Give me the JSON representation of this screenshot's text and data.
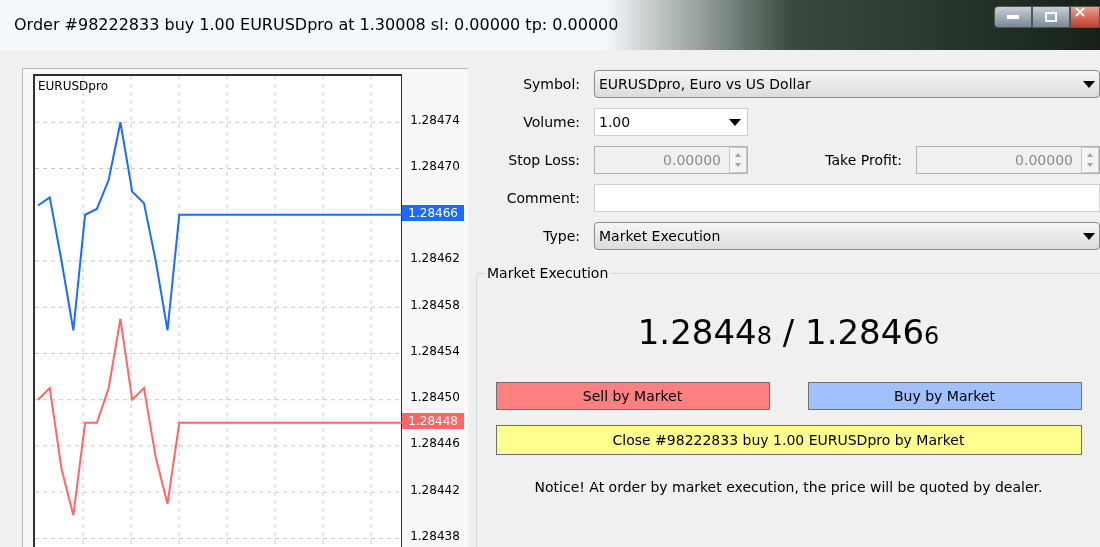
{
  "window": {
    "title": "Order #98222833 buy 1.00 EURUSDpro at 1.30008 sl: 0.00000 tp: 0.00000"
  },
  "chart": {
    "symbol": "EURUSDpro",
    "ask_label": "1.28466",
    "bid_label": "1.28448",
    "chart_data": {
      "type": "line",
      "categories": [
        null,
        null,
        null,
        null,
        null,
        null,
        null,
        null,
        null,
        null,
        null,
        null,
        null,
        null,
        null,
        null,
        null,
        null,
        null,
        null,
        null,
        null,
        null,
        null,
        null,
        null,
        null,
        null,
        null,
        null,
        null,
        null
      ],
      "ylim": [
        1.28437,
        1.28478
      ],
      "grid": true,
      "yticks": [
        {
          "value": 1.28474,
          "label": "1.28474"
        },
        {
          "value": 1.2847,
          "label": "1.28470"
        },
        {
          "value": 1.28462,
          "label": "1.28462"
        },
        {
          "value": 1.28458,
          "label": "1.28458"
        },
        {
          "value": 1.28454,
          "label": "1.28454"
        },
        {
          "value": 1.2845,
          "label": "1.28450"
        },
        {
          "value": 1.28446,
          "label": "1.28446"
        },
        {
          "value": 1.28442,
          "label": "1.28442"
        },
        {
          "value": 1.28438,
          "label": "1.28438"
        }
      ],
      "series": [
        {
          "color": "#1a6cff",
          "values": [
            1.284668,
            1.284675,
            1.28462,
            1.28456,
            1.28466,
            1.284665,
            1.28469,
            1.28474,
            1.28468,
            1.28467,
            1.28462,
            1.28456,
            1.28466,
            1.28466,
            1.28466,
            1.28466,
            1.28466,
            1.28466,
            1.28466,
            1.28466,
            1.28466,
            1.28466,
            1.28466,
            1.28466,
            1.28466,
            1.28466,
            1.28466,
            1.28466,
            1.28466,
            1.28466,
            1.28466,
            1.28466
          ]
        },
        {
          "color": "#ff6666",
          "values": [
            1.2845,
            1.28451,
            1.28444,
            1.2844,
            1.28448,
            1.28448,
            1.28451,
            1.28457,
            1.2845,
            1.28451,
            1.28445,
            1.28441,
            1.28448,
            1.28448,
            1.28448,
            1.28448,
            1.28448,
            1.28448,
            1.28448,
            1.28448,
            1.28448,
            1.28448,
            1.28448,
            1.28448,
            1.28448,
            1.28448,
            1.28448,
            1.28448,
            1.28448,
            1.28448,
            1.28448,
            1.28448
          ]
        }
      ]
    }
  },
  "form": {
    "symbol": {
      "label": "Symbol:",
      "value": "EURUSDpro, Euro vs US Dollar"
    },
    "volume": {
      "label": "Volume:",
      "value": "1.00"
    },
    "stop_loss": {
      "label": "Stop Loss:",
      "value": "0.00000",
      "disabled": true
    },
    "take_profit": {
      "label": "Take Profit:",
      "value": "0.00000",
      "disabled": true
    },
    "comment": {
      "label": "Comment:"
    },
    "type": {
      "label": "Type:",
      "value": "Market Execution"
    }
  },
  "market_execution": {
    "title": "Market Execution",
    "bid": {
      "main": "1.2844",
      "pip": "8"
    },
    "separator": "/",
    "ask": {
      "main": "1.2846",
      "pip": "6"
    },
    "buttons": [
      {
        "kind": "sell",
        "label": "Sell by Market"
      },
      {
        "kind": "buy",
        "label": "Buy by Market"
      }
    ],
    "close_button": "Close #98222833 buy 1.00 EURUSDpro by Market",
    "notice": "Notice! At order by market execution, the price will be quoted by dealer."
  }
}
